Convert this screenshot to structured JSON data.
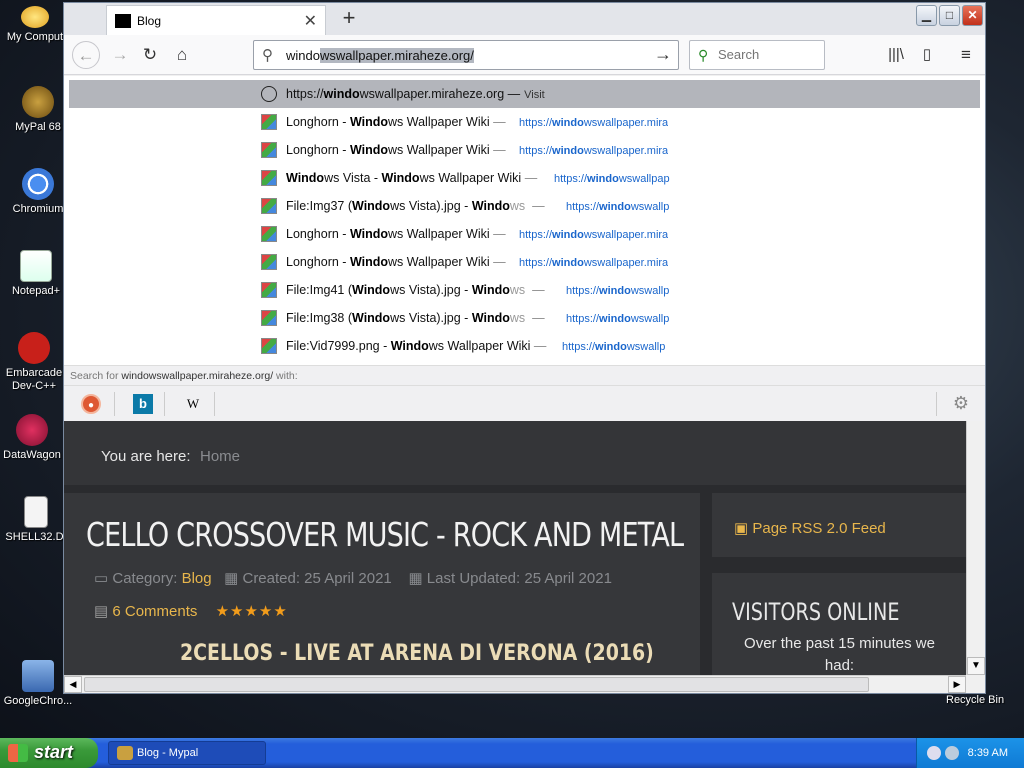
{
  "desktop": {
    "icons": [
      {
        "label": "My Comput"
      },
      {
        "label": "MyPal 68"
      },
      {
        "label": "Chromium"
      },
      {
        "label": "Notepad+"
      },
      {
        "label": "Embarcade Dev-C++"
      },
      {
        "label": "DataWagon"
      },
      {
        "label": "SHELL32.DI"
      },
      {
        "label": "GoogleChro..."
      }
    ],
    "recycle_bin": "Recycle Bin"
  },
  "browser": {
    "tab_title": "Blog",
    "url_typed": "windo",
    "url_completion": "wswallpaper.miraheze.org/",
    "search_placeholder": "Search"
  },
  "dropdown": {
    "top_row": {
      "url_bold": "windo",
      "url_rest": "wswallpaper.miraheze.org",
      "url_prefix": "https://",
      "sep": "—",
      "action": "Visit"
    },
    "rows": [
      {
        "t1": "Longhorn - ",
        "b1": "Windo",
        "t2": "ws Wallpaper Wiki",
        "u_prefix": "https://",
        "u_bold": "windo",
        "u_rest": "wswallpaper.mira"
      },
      {
        "t1": "Longhorn - ",
        "b1": "Windo",
        "t2": "ws Wallpaper Wiki",
        "u_prefix": "https://",
        "u_bold": "windo",
        "u_rest": "wswallpaper.mira"
      },
      {
        "t1": "",
        "b1": "Windo",
        "t2": "ws Vista - ",
        "b2": "Windo",
        "t3": "ws Wallpaper Wiki",
        "u_prefix": "https://",
        "u_bold": "windo",
        "u_rest": "wswallpap"
      },
      {
        "t1": "File:Img37 (",
        "b1": "Windo",
        "t2": "ws Vista).jpg - ",
        "b2": "Windo",
        "t3": "ws",
        "u_prefix": "https://",
        "u_bold": "windo",
        "u_rest": "wswallp"
      },
      {
        "t1": "Longhorn - ",
        "b1": "Windo",
        "t2": "ws Wallpaper Wiki",
        "u_prefix": "https://",
        "u_bold": "windo",
        "u_rest": "wswallpaper.mira"
      },
      {
        "t1": "Longhorn - ",
        "b1": "Windo",
        "t2": "ws Wallpaper Wiki",
        "u_prefix": "https://",
        "u_bold": "windo",
        "u_rest": "wswallpaper.mira"
      },
      {
        "t1": "File:Img41 (",
        "b1": "Windo",
        "t2": "ws Vista).jpg - ",
        "b2": "Windo",
        "t3": "ws",
        "u_prefix": "https://",
        "u_bold": "windo",
        "u_rest": "wswallp"
      },
      {
        "t1": "File:Img38 (",
        "b1": "Windo",
        "t2": "ws Vista).jpg - ",
        "b2": "Windo",
        "t3": "ws",
        "u_prefix": "https://",
        "u_bold": "windo",
        "u_rest": "wswallp"
      },
      {
        "t1": "File:Vid7999.png - ",
        "b1": "Windo",
        "t2": "ws Wallpaper Wiki",
        "u_prefix": "https://",
        "u_bold": "windo",
        "u_rest": "wswallp"
      }
    ],
    "search_with_prefix": "Search for",
    "search_with_query": "windowswallpaper.miraheze.org/",
    "search_with_suffix": "with:",
    "engine_wiki": "W"
  },
  "page": {
    "breadcrumb_label": "You are here:",
    "breadcrumb_home": "Home",
    "article_title": "CELLO CROSSOVER MUSIC - ROCK AND METAL",
    "category_label": "Category:",
    "category": "Blog",
    "created": "Created: 25 April 2021",
    "updated": "Last Updated: 25 April 2021",
    "comments": "6 Comments",
    "stars": "★★★★★",
    "subtitle": "2CELLOS - LIVE AT ARENA DI VERONA (2016)",
    "rss": "Page RSS 2.0 Feed",
    "visitors_heading": "VISITORS ONLINE",
    "visitors_text": "Over the past 15 minutes we had:"
  },
  "taskbar": {
    "start": "start",
    "task": "Blog - Mypal",
    "clock": "8:39 AM"
  }
}
